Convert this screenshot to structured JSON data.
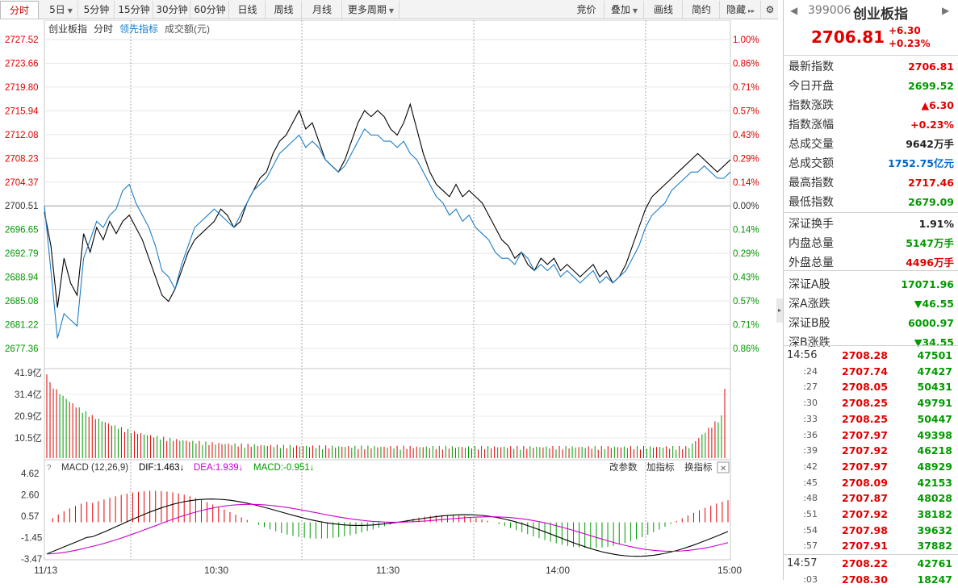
{
  "toolbar": {
    "tabs": [
      {
        "label": "分时",
        "active": true
      },
      {
        "label": "5日",
        "caret": true
      },
      {
        "label": "5分钟"
      },
      {
        "label": "15分钟"
      },
      {
        "label": "30分钟"
      },
      {
        "label": "60分钟"
      },
      {
        "label": "日线"
      },
      {
        "label": "周线"
      },
      {
        "label": "月线"
      },
      {
        "label": "更多周期",
        "caret": true
      }
    ],
    "right_tools": [
      {
        "label": "竞价"
      },
      {
        "label": "叠加",
        "caret": true
      },
      {
        "label": "画线"
      },
      {
        "label": "简约"
      },
      {
        "label": "隐藏",
        "arrow": "▸▸"
      }
    ]
  },
  "chart_header": {
    "name": "创业板指",
    "period": "分时",
    "leading_indicator": "领先指标",
    "turnover": "成交额(元)"
  },
  "chart_data": [
    {
      "type": "line",
      "price_axis": [
        "2727.52",
        "2723.66",
        "2719.80",
        "2715.94",
        "2712.08",
        "2708.23",
        "2704.37",
        "2700.51",
        "2696.65",
        "2692.79",
        "2688.94",
        "2685.08",
        "2681.22",
        "2677.36"
      ],
      "pct_axis": [
        "1.00%",
        "0.86%",
        "0.71%",
        "0.57%",
        "0.43%",
        "0.29%",
        "0.14%",
        "0.00%",
        "0.14%",
        "0.29%",
        "0.43%",
        "0.57%",
        "0.71%",
        "0.86%"
      ],
      "prev_close": 2700.51,
      "ylim": [
        2677.36,
        2727.52
      ],
      "series": [
        {
          "name": "创业板指",
          "color": "#000000",
          "values": [
            2699.5,
            2694,
            2684,
            2692,
            2688,
            2686,
            2696,
            2693,
            2697,
            2695,
            2698,
            2696,
            2698,
            2699,
            2697,
            2695,
            2692,
            2689,
            2686,
            2685,
            2687,
            2690,
            2693,
            2695,
            2696,
            2697,
            2698,
            2700,
            2699,
            2697,
            2698,
            2701,
            2703,
            2705,
            2706,
            2709,
            2711,
            2712,
            2714,
            2716,
            2713,
            2714,
            2711,
            2708,
            2707,
            2706,
            2708,
            2711,
            2714,
            2716,
            2715,
            2716,
            2715,
            2713,
            2712,
            2714,
            2717,
            2713,
            2709,
            2706,
            2704,
            2703,
            2702,
            2704,
            2702,
            2703,
            2702,
            2701,
            2699,
            2697,
            2695,
            2694,
            2692,
            2693,
            2691,
            2690,
            2692,
            2691,
            2692,
            2690,
            2691,
            2690,
            2689,
            2690,
            2691,
            2689,
            2690,
            2688,
            2689,
            2691,
            2694,
            2697,
            2700,
            2702,
            2703,
            2704,
            2705,
            2706,
            2707,
            2708,
            2709,
            2708,
            2707,
            2706,
            2707,
            2708
          ]
        },
        {
          "name": "领先指标",
          "color": "#1a7dc8",
          "values": [
            2700.5,
            2690,
            2679,
            2683,
            2682,
            2681,
            2692,
            2695,
            2698,
            2697,
            2699,
            2700,
            2703,
            2704,
            2701,
            2699,
            2697,
            2694,
            2690,
            2689,
            2687,
            2691,
            2694,
            2697,
            2698,
            2699,
            2700,
            2699,
            2698,
            2697,
            2699,
            2701,
            2703,
            2704,
            2705,
            2707,
            2709,
            2710,
            2711,
            2712,
            2710,
            2711,
            2710,
            2708,
            2707,
            2706,
            2707,
            2709,
            2711,
            2713,
            2712,
            2712,
            2711,
            2711,
            2710,
            2711,
            2709,
            2708,
            2706,
            2704,
            2702,
            2701,
            2699,
            2700,
            2698,
            2699,
            2697,
            2696,
            2695,
            2693,
            2692,
            2692,
            2691,
            2693,
            2692,
            2690,
            2691,
            2690,
            2691,
            2689,
            2690,
            2689,
            2688,
            2689,
            2690,
            2688,
            2689,
            2688,
            2689,
            2690,
            2692,
            2694,
            2697,
            2699,
            2700,
            2701,
            2703,
            2704,
            2705,
            2706,
            2706,
            2707,
            2706,
            2705,
            2705,
            2706
          ]
        }
      ]
    },
    {
      "type": "bar",
      "title": "成交额",
      "axis": [
        "41.9亿",
        "31.4亿",
        "20.9亿",
        "10.5亿"
      ],
      "ylim": [
        0,
        41.9
      ]
    },
    {
      "type": "bar",
      "title": "MACD (12,26,9)",
      "dif_label": "DIF:1.463",
      "dea_label": "DEA:1.939",
      "macd_label": "MACD:-0.951",
      "axis": [
        "4.62",
        "2.60",
        "0.57",
        "-1.45",
        "-3.47"
      ],
      "ylim": [
        -3.47,
        4.62
      ],
      "actions": [
        "改参数",
        "加指标",
        "换指标"
      ],
      "series": [
        {
          "name": "DIF",
          "color": "#000000"
        },
        {
          "name": "DEA",
          "color": "#cc00cc"
        }
      ]
    }
  ],
  "time_axis": [
    "11/13",
    "10:30",
    "11:30",
    "14:00",
    "15:00"
  ],
  "right_panel": {
    "code": "399006",
    "name": "创业板指",
    "price": "2706.81",
    "change": "+6.30",
    "change_pct": "+0.23%",
    "stats": [
      {
        "label": "最新指数",
        "value": "2706.81",
        "color": "red"
      },
      {
        "label": "今日开盘",
        "value": "2699.52",
        "color": "green"
      },
      {
        "label": "指数涨跌",
        "value": "▲6.30",
        "color": "red"
      },
      {
        "label": "指数涨幅",
        "value": "+0.23%",
        "color": "red"
      },
      {
        "label": "总成交量",
        "value": "9642万手",
        "color": "black"
      },
      {
        "label": "总成交额",
        "value": "1752.75亿元",
        "color": "blue"
      },
      {
        "label": "最高指数",
        "value": "2717.46",
        "color": "red"
      },
      {
        "label": "最低指数",
        "value": "2679.09",
        "color": "green"
      },
      {
        "label": "深证换手",
        "value": "1.91%",
        "color": "black"
      },
      {
        "label": "内盘总量",
        "value": "5147万手",
        "color": "green"
      },
      {
        "label": "外盘总量",
        "value": "4496万手",
        "color": "red"
      },
      {
        "label": "深证A股",
        "value": "17071.96",
        "color": "green"
      },
      {
        "label": "深A涨跌",
        "value": "▼46.55",
        "color": "green"
      },
      {
        "label": "深证B股",
        "value": "6000.97",
        "color": "green"
      },
      {
        "label": "深B涨跌",
        "value": "▼34.55",
        "color": "green"
      }
    ],
    "ticks": [
      {
        "time": "14:56",
        "price": "2708.28",
        "vol": "47501",
        "full": true
      },
      {
        "time": ":24",
        "price": "2707.74",
        "vol": "47427"
      },
      {
        "time": ":27",
        "price": "2708.05",
        "vol": "50431"
      },
      {
        "time": ":30",
        "price": "2708.25",
        "vol": "49791"
      },
      {
        "time": ":33",
        "price": "2708.25",
        "vol": "50447"
      },
      {
        "time": ":36",
        "price": "2707.97",
        "vol": "49398"
      },
      {
        "time": ":39",
        "price": "2707.92",
        "vol": "46218"
      },
      {
        "time": ":42",
        "price": "2707.97",
        "vol": "48929"
      },
      {
        "time": ":45",
        "price": "2708.09",
        "vol": "42153"
      },
      {
        "time": ":48",
        "price": "2707.87",
        "vol": "48028"
      },
      {
        "time": ":51",
        "price": "2707.92",
        "vol": "38182"
      },
      {
        "time": ":54",
        "price": "2707.98",
        "vol": "39632"
      },
      {
        "time": ":57",
        "price": "2707.91",
        "vol": "37882"
      },
      {
        "time": "14:57",
        "price": "2708.22",
        "vol": "42761",
        "full": true
      },
      {
        "time": ":03",
        "price": "2708.30",
        "vol": "18247"
      }
    ]
  }
}
